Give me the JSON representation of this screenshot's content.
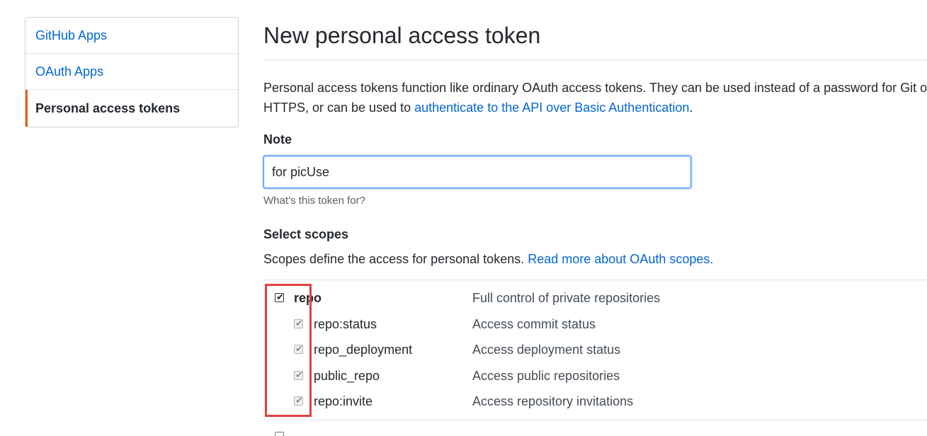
{
  "sidebar": {
    "items": [
      {
        "label": "GitHub Apps"
      },
      {
        "label": "OAuth Apps"
      },
      {
        "label": "Personal access tokens"
      }
    ]
  },
  "main": {
    "title": "New personal access token",
    "description_text": "Personal access tokens function like ordinary OAuth access tokens. They can be used instead of a password for Git over",
    "description_text_2": "HTTPS, or can be used to ",
    "description_link": "authenticate to the API over Basic Authentication",
    "description_end": ".",
    "note_label": "Note",
    "note_value": "for picUse",
    "note_hint": "What’s this token for?",
    "scopes_label": "Select scopes",
    "scopes_desc_text": "Scopes define the access for personal tokens. ",
    "scopes_desc_link": "Read more about OAuth scopes.",
    "scopes": [
      {
        "name": "repo",
        "description": "Full control of private repositories"
      },
      {
        "name": "repo:status",
        "description": "Access commit status"
      },
      {
        "name": "repo_deployment",
        "description": "Access deployment status"
      },
      {
        "name": "public_repo",
        "description": "Access public repositories"
      },
      {
        "name": "repo:invite",
        "description": "Access repository invitations"
      }
    ]
  },
  "colors": {
    "link": "#0366d6",
    "active_accent": "#e36209",
    "highlight": "#e0403f"
  }
}
